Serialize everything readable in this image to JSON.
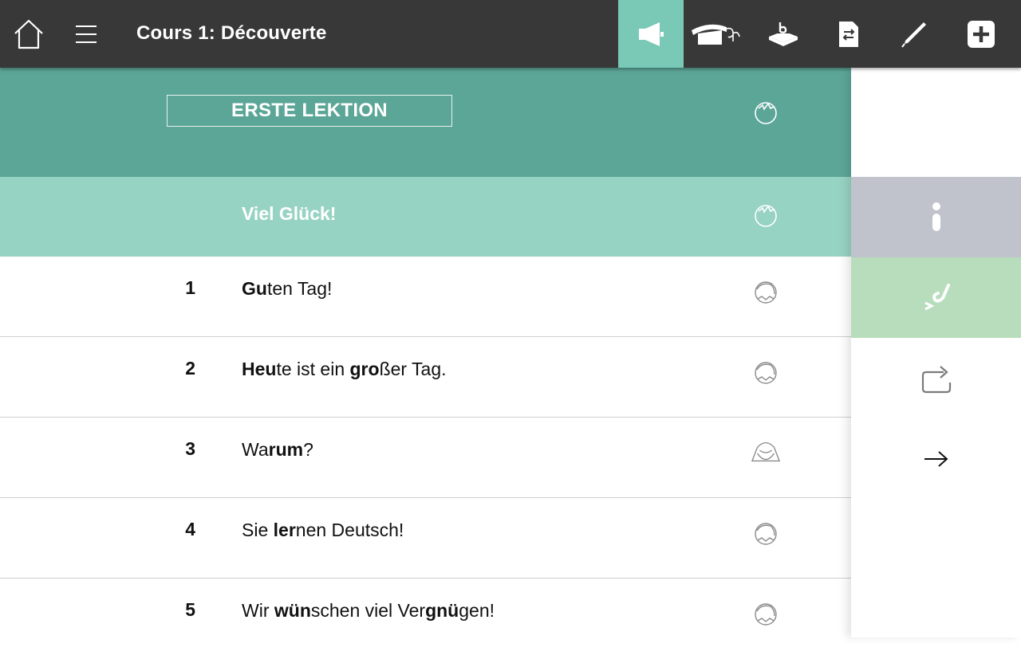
{
  "topbar": {
    "title": "Cours 1: Découverte",
    "icons": [
      "home-icon",
      "menu-icon",
      "megaphone-icon",
      "graduation-cap-icon",
      "book-stand-icon",
      "document-transfer-icon",
      "pen-icon",
      "add-icon"
    ],
    "active_tool": "megaphone-icon",
    "accent_color": "#79c9b6",
    "bar_color": "#383838"
  },
  "lesson": {
    "heading": "ERSTE LEKTION",
    "subtitle": "Viel Glück!",
    "header_color": "#5ca698",
    "subtitle_color": "#97d3c2"
  },
  "rows": [
    {
      "num": "1",
      "bold1": "Gu",
      "rest1": "ten Tag!",
      "bold2": "",
      "rest2": ""
    },
    {
      "num": "2",
      "bold1": "Heu",
      "rest1": "te ist ein ",
      "bold2": "gro",
      "rest2": "ßer Tag."
    },
    {
      "num": "3",
      "bold1": "",
      "rest1": "Wa",
      "bold2": "rum",
      "rest2": "?"
    },
    {
      "num": "4",
      "bold1": "",
      "rest1": "Sie ",
      "bold2": "ler",
      "rest2": "nen Deutsch!"
    },
    {
      "num": "5",
      "bold1": "",
      "rest1": "Wir ",
      "bold2": "wün",
      "rest2": "schen viel Ver",
      "bold3": "gnü",
      "rest3": "gen!"
    }
  ],
  "side_panel": {
    "buttons": [
      "info-icon",
      "check-exercise-icon",
      "repeat-icon",
      "next-arrow-icon"
    ],
    "info_color": "#c0c3cc",
    "exercise_color": "#b7ddbc"
  }
}
